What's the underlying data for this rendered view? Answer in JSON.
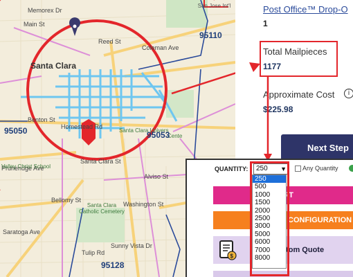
{
  "map": {
    "city_label": "Santa Clara",
    "zip_labels": [
      "95110",
      "95050",
      "95053",
      "95128"
    ],
    "road_labels": [
      "Memorex Dr",
      "Main St",
      "Reed St",
      "Coleman Ave",
      "Benton St",
      "Homestead Rd",
      "Santa Clara St",
      "Bellomy St",
      "Washington St",
      "Alviso St",
      "Tulip Rd",
      "Sunny Vista Dr",
      "Saratoga Ave",
      "Pruneridge Ave"
    ],
    "place_labels": [
      "San Jose Int'l",
      "Santa Clara Univers",
      "Valley Christ School",
      "Santa Clara Catholic Cemetery",
      "Cente"
    ],
    "circle_color": "#e3262b",
    "route_color": "#6ec6f0"
  },
  "panel": {
    "post_office_link": "Post Office™ Drop-O",
    "post_office_count": "1",
    "total_mailpieces_label": "Total Mailpieces",
    "total_mailpieces_value": "1177",
    "approx_cost_label": "Approximate Cost",
    "approx_cost_value": "$225.98",
    "next_step_label": "Next Step"
  },
  "inset": {
    "quantity_label": "QUANTITY:",
    "quantity_selected": "250",
    "any_quantity_label": "Any Quantity",
    "add_to_cart_label": "O CART",
    "configuration_label": "CONFIGURATION",
    "custom_quote_label": "Re          a Custom Quote",
    "options": [
      "250",
      "500",
      "1000",
      "1500",
      "2000",
      "2500",
      "3000",
      "5000",
      "6000",
      "7000",
      "8000"
    ]
  },
  "colors": {
    "accent_red": "#e3262b",
    "next_step_bg": "#2e3468",
    "cart_btn": "#e02a8a",
    "config_btn": "#f6801e",
    "quote_btn": "#e1d3ef"
  }
}
